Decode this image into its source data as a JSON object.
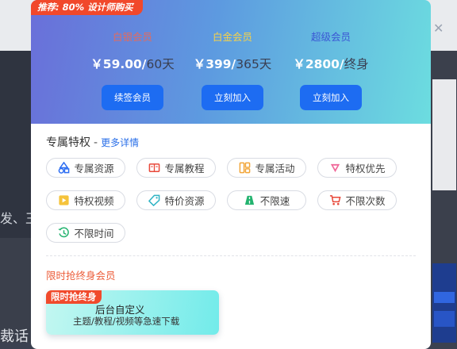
{
  "promo_badge": "推荐: 80% 设计师购买",
  "tiers": [
    {
      "name": "白银会员",
      "color": "#e26b5f",
      "price": "￥59.00/",
      "duration": "60天",
      "button": "续签会员"
    },
    {
      "name": "白金会员",
      "color": "#f5d14a",
      "price": "￥399/",
      "duration": "365天",
      "button": "立刻加入"
    },
    {
      "name": "超级会员",
      "color": "#3b57d4",
      "price": "￥2800/",
      "duration": "终身",
      "button": "立刻加入"
    }
  ],
  "privileges": {
    "title": "专属特权",
    "more_link": "更多详情",
    "items": [
      {
        "label": "专属资源",
        "icon": "resource-icon"
      },
      {
        "label": "专属教程",
        "icon": "tutorial-icon"
      },
      {
        "label": "专属活动",
        "icon": "activity-icon"
      },
      {
        "label": "特权优先",
        "icon": "priority-icon"
      },
      {
        "label": "特权视频",
        "icon": "video-icon"
      },
      {
        "label": "特价资源",
        "icon": "discount-tag-icon"
      },
      {
        "label": "不限速",
        "icon": "road-icon"
      },
      {
        "label": "不限次数",
        "icon": "cart-icon"
      },
      {
        "label": "不限时间",
        "icon": "clock-icon"
      }
    ]
  },
  "limited": {
    "title": "限时抢终身会员",
    "tag": "限时抢终身",
    "line1": "后台自定义",
    "line2": "主题/教程/视频等急速下载"
  },
  "background": {
    "left_text": "发、王",
    "left_bottom_text": "裁话"
  },
  "colors": {
    "accent": "#1d6cf2",
    "promo": "#f1482b",
    "hero_start": "#6a6fd9",
    "hero_end": "#6cdde0"
  }
}
